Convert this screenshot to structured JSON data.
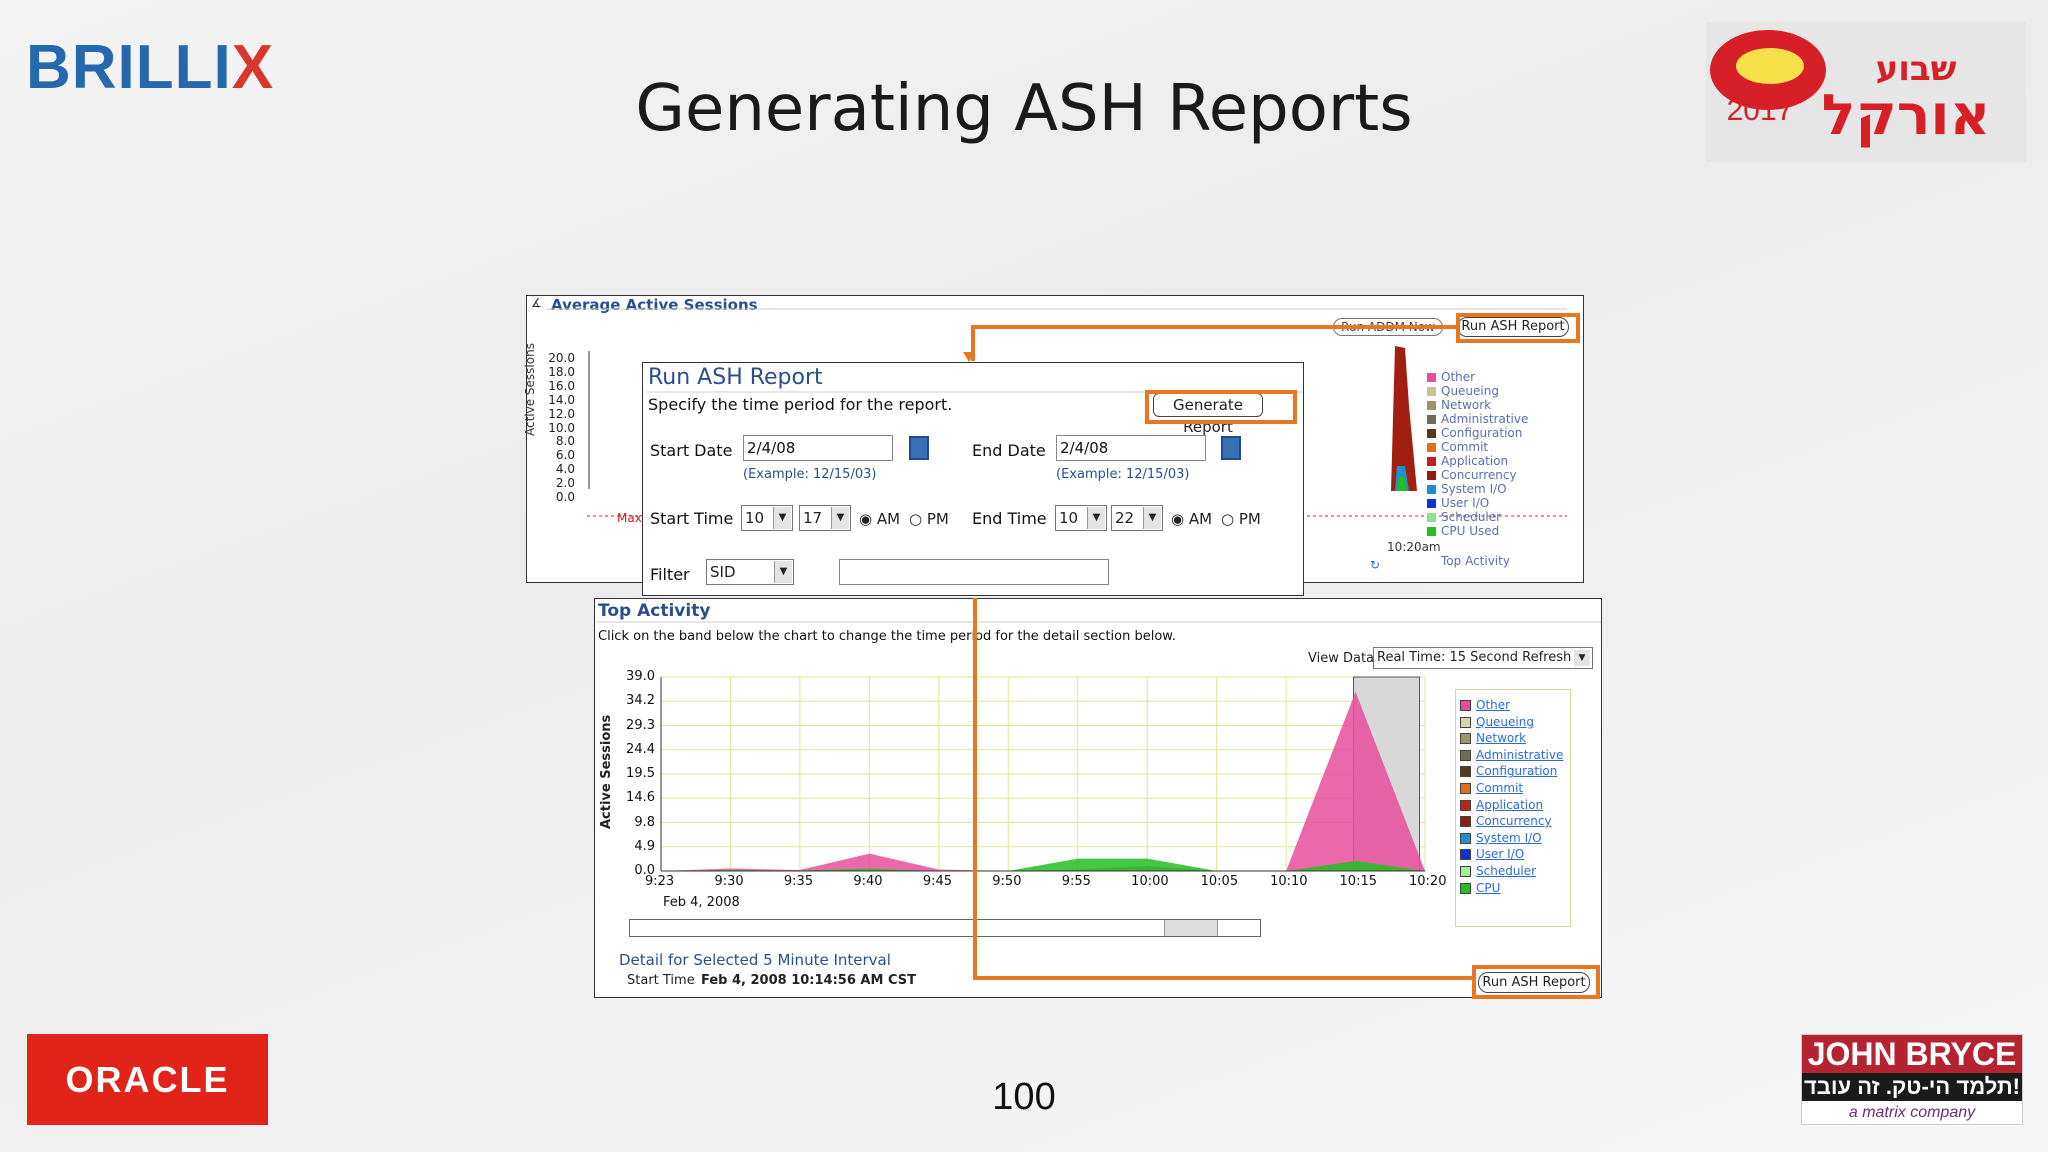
{
  "header": {
    "brand_left": "BRILLIX",
    "brand_left_main": "BRILLI",
    "brand_left_x": "X",
    "title": "Generating ASH Reports",
    "event_logo_line1": "שבוע",
    "event_logo_line2": "אורקל",
    "event_year": "2017"
  },
  "footer": {
    "oracle_logo": "ORACLE",
    "page_number": "100",
    "jb_line1": "JOHN BRYCE",
    "jb_line2": "תלמד הי-טק. זה עובד!",
    "jb_line3": "a matrix company"
  },
  "aas": {
    "title": "Average Active Sessions",
    "ylabel": "Active Sessions",
    "yticks": [
      "20.0",
      "18.0",
      "16.0",
      "14.0",
      "12.0",
      "10.0",
      "8.0",
      "6.0",
      "4.0",
      "2.0",
      "0.0"
    ],
    "max_label": "Max",
    "addm_button": "Run ADDM Now",
    "ash_button": "Run ASH Report",
    "time_label": "10:20am",
    "footer_link": "Top Activity",
    "legend": [
      {
        "label": "Other",
        "color": "#e84f9b"
      },
      {
        "label": "Queueing",
        "color": "#c8c39a"
      },
      {
        "label": "Network",
        "color": "#9b9670"
      },
      {
        "label": "Administrative",
        "color": "#6f6b55"
      },
      {
        "label": "Configuration",
        "color": "#5a3a1a"
      },
      {
        "label": "Commit",
        "color": "#e07020"
      },
      {
        "label": "Application",
        "color": "#c0201a"
      },
      {
        "label": "Concurrency",
        "color": "#8b2010"
      },
      {
        "label": "System I/O",
        "color": "#1e90d0"
      },
      {
        "label": "User I/O",
        "color": "#1030d0"
      },
      {
        "label": "Scheduler",
        "color": "#90e090"
      },
      {
        "label": "CPU Used",
        "color": "#20c020"
      }
    ]
  },
  "dialog": {
    "title": "Run ASH Report",
    "subtitle": "Specify the time period for the report.",
    "generate_button": "Generate Report",
    "start_date_label": "Start Date",
    "start_date": "2/4/08",
    "start_date_example": "(Example: 12/15/03)",
    "end_date_label": "End Date",
    "end_date": "2/4/08",
    "end_date_example": "(Example: 12/15/03)",
    "start_time_label": "Start Time",
    "start_hour": "10",
    "start_min": "17",
    "end_time_label": "End Time",
    "end_hour": "10",
    "end_min": "22",
    "am": "AM",
    "pm": "PM",
    "filter_label": "Filter",
    "filter_value": "SID",
    "filter_text": ""
  },
  "top_activity": {
    "title": "Top Activity",
    "subtitle": "Click on the band below the chart to change the time period for the detail section below.",
    "view_data_label": "View Data",
    "view_data_value": "Real Time: 15 Second Refresh",
    "ylabel": "Active Sessions",
    "date_label": "Feb 4, 2008",
    "detail_label": "Detail for Selected 5 Minute Interval",
    "start_time_label": "Start Time",
    "start_time_value": "Feb 4, 2008 10:14:56 AM CST",
    "ash_button": "Run ASH Report",
    "legend": [
      {
        "label": "Other",
        "color": "#e84f9b"
      },
      {
        "label": "Queueing",
        "color": "#d8d3aa"
      },
      {
        "label": "Network",
        "color": "#9b9670"
      },
      {
        "label": "Administrative",
        "color": "#6f6b55"
      },
      {
        "label": "Configuration",
        "color": "#5a3a1a"
      },
      {
        "label": "Commit",
        "color": "#e07020"
      },
      {
        "label": "Application",
        "color": "#c0201a"
      },
      {
        "label": "Concurrency",
        "color": "#8b2010"
      },
      {
        "label": "System I/O",
        "color": "#1e90d0"
      },
      {
        "label": "User I/O",
        "color": "#1030d0"
      },
      {
        "label": "Scheduler",
        "color": "#a0f0a0"
      },
      {
        "label": "CPU",
        "color": "#20c020"
      }
    ]
  },
  "chart_data": {
    "type": "area",
    "title": "Top Activity",
    "xlabel": "",
    "ylabel": "Active Sessions",
    "x": [
      "9:23",
      "9:30",
      "9:35",
      "9:40",
      "9:45",
      "9:50",
      "9:55",
      "10:00",
      "10:05",
      "10:10",
      "10:15",
      "10:20"
    ],
    "yticks": [
      "39.0",
      "34.2",
      "29.3",
      "24.4",
      "19.5",
      "14.6",
      "9.8",
      "4.9",
      "0.0"
    ],
    "ylim": [
      0,
      39.0
    ],
    "grid": true,
    "legend": "right",
    "series": [
      {
        "name": "Other",
        "values": [
          0,
          0.5,
          0.2,
          3.5,
          0.3,
          0,
          0.3,
          1,
          0,
          0,
          36,
          0
        ]
      },
      {
        "name": "CPU",
        "values": [
          0,
          0.2,
          0.1,
          0.5,
          0,
          0,
          2.5,
          2.5,
          0,
          0,
          2,
          0
        ]
      }
    ]
  }
}
